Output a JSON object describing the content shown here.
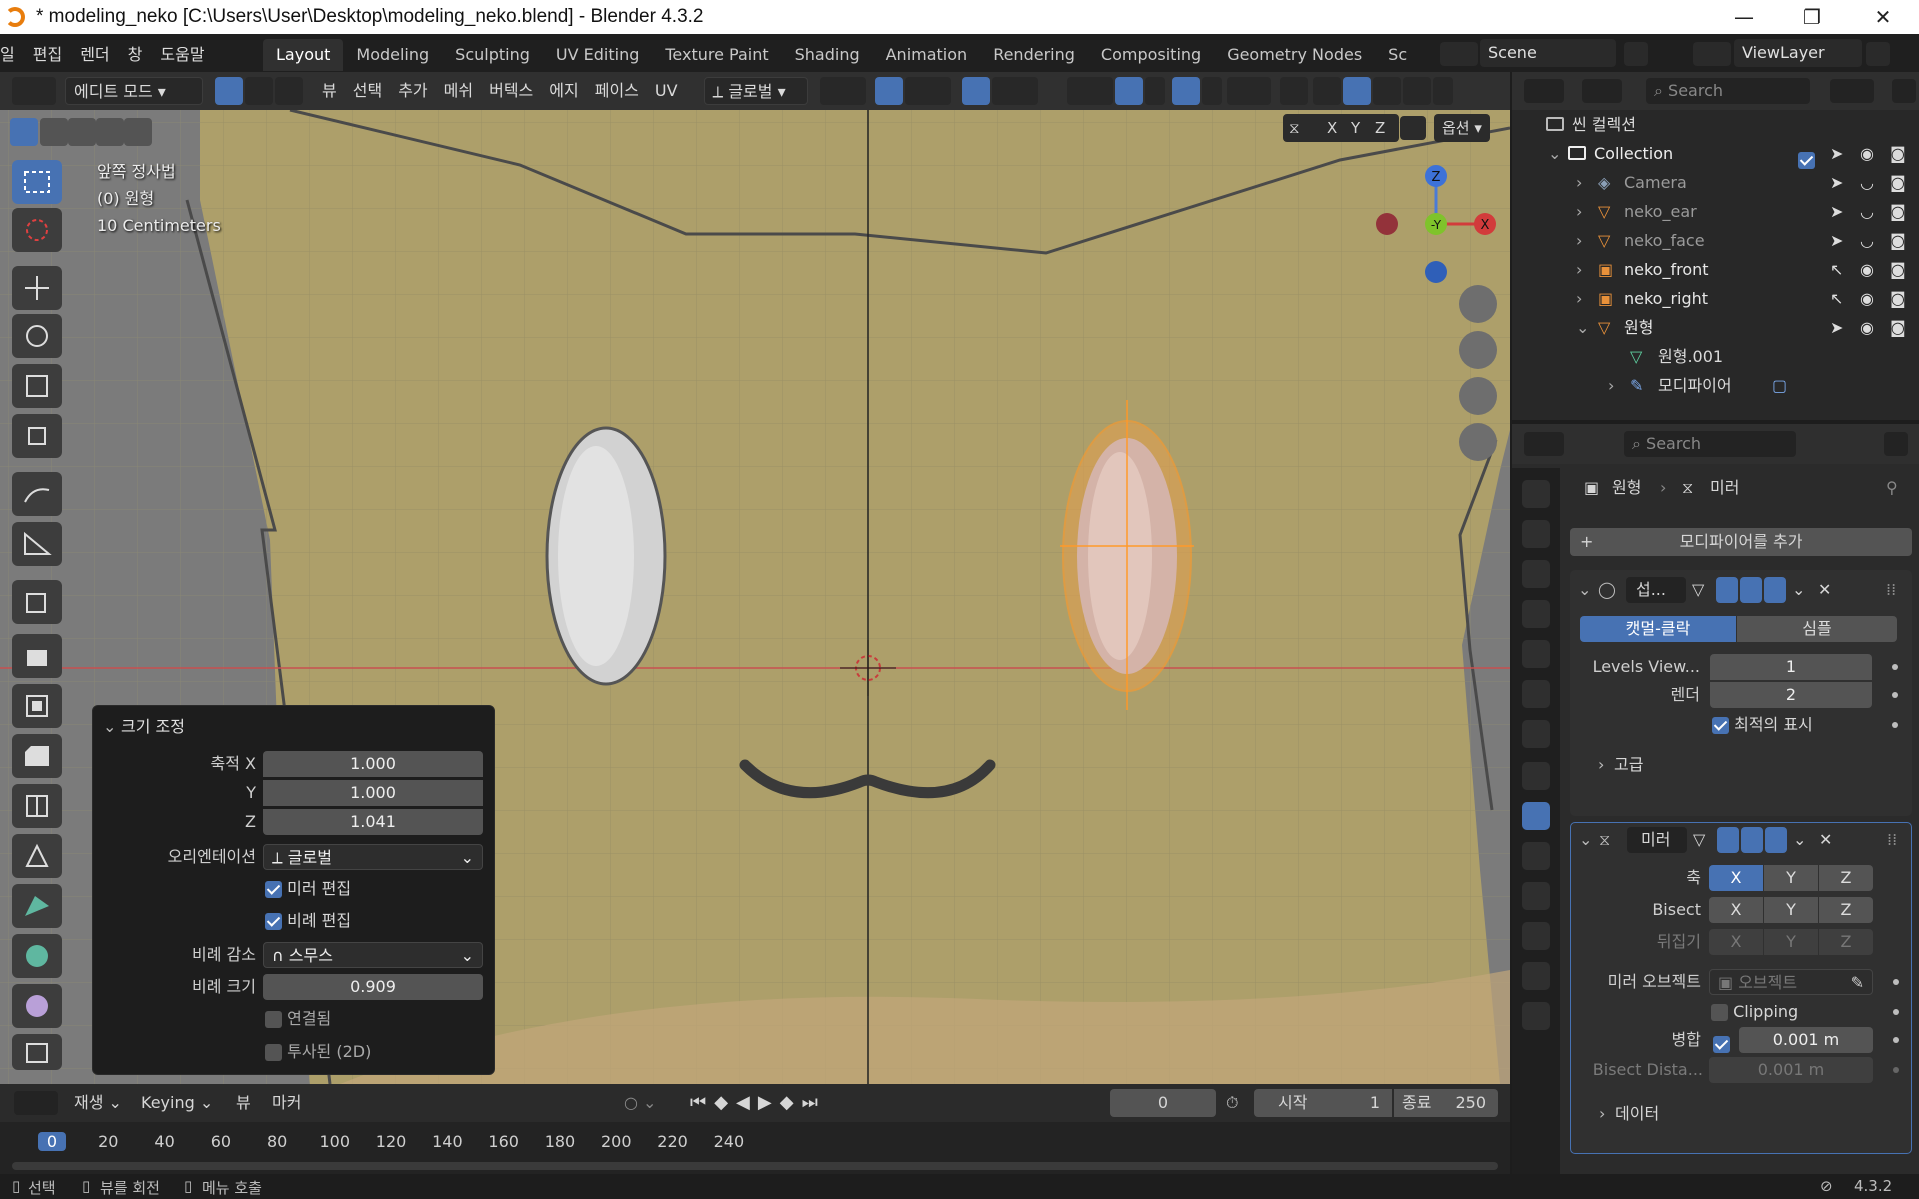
{
  "window": {
    "title": "* modeling_neko [C:\\Users\\User\\Desktop\\modeling_neko.blend] - Blender 4.3.2",
    "minimize": "—",
    "restore": "❐",
    "close": "✕"
  },
  "menubar": {
    "items": [
      "일",
      "편집",
      "렌더",
      "창",
      "도움말"
    ],
    "workspaces": [
      "Layout",
      "Modeling",
      "Sculpting",
      "UV Editing",
      "Texture Paint",
      "Shading",
      "Animation",
      "Rendering",
      "Compositing",
      "Geometry Nodes",
      "Sc"
    ],
    "active_workspace": "Layout",
    "scene": "Scene",
    "view_layer": "ViewLayer"
  },
  "header": {
    "mode": "에디트 모드",
    "menus": [
      "뷰",
      "선택",
      "추가",
      "메쉬",
      "버텍스",
      "에지",
      "페이스",
      "UV"
    ],
    "orientation": "글로벌",
    "axis_x": "X",
    "axis_y": "Y",
    "axis_z": "Z",
    "options": "옵션"
  },
  "viewport": {
    "view_name": "앞쪽 정사법",
    "object_name": "(0) 원형",
    "scale": "10 Centimeters",
    "gizmo_x": "X",
    "gizmo_y": "-Y",
    "gizmo_z": "Z"
  },
  "redo_panel": {
    "title": "크기 조정",
    "scale_x_label": "축적 X",
    "scale_y_label": "Y",
    "scale_z_label": "Z",
    "scale_x": "1.000",
    "scale_y": "1.000",
    "scale_z": "1.041",
    "orientation_label": "오리엔테이션",
    "orientation": "글로벌",
    "mirror_edit": "미러 편집",
    "proportional_edit": "비례 편집",
    "falloff_label": "비례 감소",
    "falloff": "스무스",
    "size_label": "비례 크기",
    "size": "0.909",
    "connected": "연결됨",
    "projected": "투사된 (2D)"
  },
  "timeline": {
    "menus": [
      "재생",
      "Keying",
      "뷰",
      "마커"
    ],
    "current_frame": "0",
    "start_label": "시작",
    "start": "1",
    "end_label": "종료",
    "end": "250",
    "ruler": [
      "0",
      "20",
      "40",
      "60",
      "80",
      "100",
      "120",
      "140",
      "160",
      "180",
      "200",
      "220",
      "240"
    ],
    "playhead": 0
  },
  "statusbar": {
    "select": "선택",
    "rotate": "뷰를 회전",
    "menu": "메뉴 호출",
    "version": "4.3.2"
  },
  "outliner": {
    "search_placeholder": "Search",
    "root": "씬 컬렉션",
    "collection": "Collection",
    "items": [
      "Camera",
      "neko_ear",
      "neko_face",
      "neko_front",
      "neko_right",
      "원형"
    ],
    "child_mesh": "원형.001",
    "child_modifiers": "모디파이어"
  },
  "properties": {
    "search_placeholder": "Search",
    "breadcrumb_object": "원형",
    "breadcrumb_modifier": "미러",
    "add_modifier": "모디파이어를 추가",
    "subsurf": {
      "name": "섭...",
      "catmull": "캣멀-클락",
      "simple": "심플",
      "levels_label": "Levels View...",
      "levels": "1",
      "render_label": "렌더",
      "render": "2",
      "optimal": "최적의 표시",
      "advanced": "고급"
    },
    "mirror": {
      "name": "미러",
      "axis_label": "축",
      "bisect_label": "Bisect",
      "flip_label": "뒤집기",
      "x": "X",
      "y": "Y",
      "z": "Z",
      "object_label": "미러 오브젝트",
      "object_placeholder": "오브젝트",
      "clipping": "Clipping",
      "merge_label": "병합",
      "merge": "0.001 m",
      "bisect_dist_label": "Bisect Dista...",
      "bisect_dist": "0.001 m",
      "data": "데이터"
    }
  }
}
